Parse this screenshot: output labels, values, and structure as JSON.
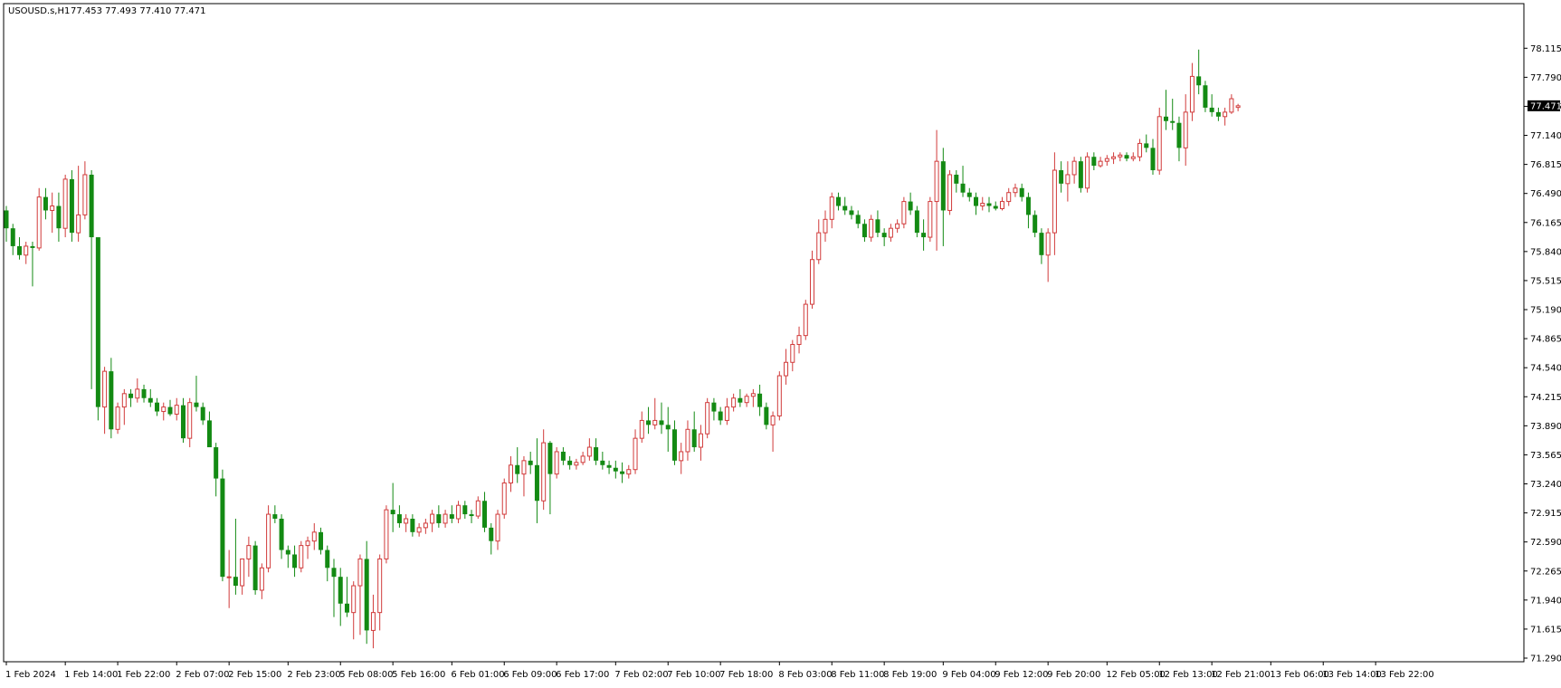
{
  "header": {
    "symbol": "USOUSD.s,H1",
    "ohlc": "77.453 77.493 77.410 77.471"
  },
  "colors": {
    "background": "#ffffff",
    "frame": "#000000",
    "bull": "#d13a3a",
    "bear": "#138a13",
    "price_label_bg": "#000000",
    "price_label_text": "#ffffff"
  },
  "chart_data": {
    "type": "candlestick",
    "grid": false,
    "ylim": [
      71.29,
      78.28
    ],
    "y_ticks": [
      "78.115",
      "77.790",
      "77.465",
      "77.140",
      "76.815",
      "76.490",
      "76.165",
      "75.840",
      "75.515",
      "75.190",
      "74.865",
      "74.540",
      "74.215",
      "73.890",
      "73.565",
      "73.240",
      "72.915",
      "72.590",
      "72.265",
      "71.940",
      "71.615",
      "71.290"
    ],
    "current_price": "77.471",
    "x_ticks": [
      {
        "label": "1 Feb 2024",
        "index": 0
      },
      {
        "label": "1 Feb 14:00",
        "index": 9
      },
      {
        "label": "1 Feb 22:00",
        "index": 17
      },
      {
        "label": "2 Feb 07:00",
        "index": 26
      },
      {
        "label": "2 Feb 15:00",
        "index": 34
      },
      {
        "label": "2 Feb 23:00",
        "index": 43
      },
      {
        "label": "5 Feb 08:00",
        "index": 51
      },
      {
        "label": "5 Feb 16:00",
        "index": 59
      },
      {
        "label": "6 Feb 01:00",
        "index": 68
      },
      {
        "label": "6 Feb 09:00",
        "index": 76
      },
      {
        "label": "6 Feb 17:00",
        "index": 84
      },
      {
        "label": "7 Feb 02:00",
        "index": 93
      },
      {
        "label": "7 Feb 10:00",
        "index": 101
      },
      {
        "label": "7 Feb 18:00",
        "index": 109
      },
      {
        "label": "8 Feb 03:00",
        "index": 118
      },
      {
        "label": "8 Feb 11:00",
        "index": 126
      },
      {
        "label": "8 Feb 19:00",
        "index": 134
      },
      {
        "label": "9 Feb 04:00",
        "index": 143
      },
      {
        "label": "9 Feb 12:00",
        "index": 151
      },
      {
        "label": "9 Feb 20:00",
        "index": 159
      },
      {
        "label": "12 Feb 05:00",
        "index": 168
      },
      {
        "label": "12 Feb 13:00",
        "index": 176
      },
      {
        "label": "12 Feb 21:00",
        "index": 184
      },
      {
        "label": "13 Feb 06:00",
        "index": 193
      },
      {
        "label": "13 Feb 14:00",
        "index": 201
      },
      {
        "label": "13 Feb 22:00",
        "index": 209
      }
    ],
    "candles": [
      [
        76.3,
        76.35,
        75.95,
        76.1
      ],
      [
        76.1,
        76.15,
        75.8,
        75.9
      ],
      [
        75.9,
        76.0,
        75.75,
        75.8
      ],
      [
        75.8,
        75.95,
        75.7,
        75.9
      ],
      [
        75.9,
        75.95,
        75.45,
        75.88
      ],
      [
        75.88,
        76.55,
        75.85,
        76.45
      ],
      [
        76.45,
        76.55,
        76.2,
        76.3
      ],
      [
        76.3,
        76.5,
        76.05,
        76.35
      ],
      [
        76.35,
        76.5,
        75.95,
        76.1
      ],
      [
        76.1,
        76.7,
        76.0,
        76.65
      ],
      [
        76.65,
        76.75,
        75.95,
        76.05
      ],
      [
        76.05,
        76.8,
        75.95,
        76.25
      ],
      [
        76.25,
        76.85,
        76.2,
        76.7
      ],
      [
        76.7,
        76.75,
        74.3,
        76.0
      ],
      [
        76.0,
        75.75,
        73.95,
        74.1
      ],
      [
        74.1,
        74.55,
        73.8,
        74.5
      ],
      [
        74.5,
        74.65,
        73.75,
        73.85
      ],
      [
        73.85,
        74.15,
        73.8,
        74.1
      ],
      [
        74.1,
        74.3,
        73.9,
        74.25
      ],
      [
        74.25,
        74.3,
        74.1,
        74.2
      ],
      [
        74.2,
        74.42,
        74.15,
        74.3
      ],
      [
        74.3,
        74.35,
        74.15,
        74.2
      ],
      [
        74.2,
        74.3,
        74.1,
        74.15
      ],
      [
        74.15,
        74.2,
        74.0,
        74.05
      ],
      [
        74.05,
        74.15,
        73.95,
        74.1
      ],
      [
        74.1,
        74.18,
        74.0,
        74.02
      ],
      [
        74.02,
        74.2,
        73.95,
        74.12
      ],
      [
        74.12,
        74.2,
        73.7,
        73.75
      ],
      [
        73.75,
        74.2,
        73.65,
        74.15
      ],
      [
        74.15,
        74.45,
        74.05,
        74.1
      ],
      [
        74.1,
        74.15,
        73.9,
        73.95
      ],
      [
        73.95,
        74.05,
        73.7,
        73.65
      ],
      [
        73.65,
        73.7,
        73.1,
        73.3
      ],
      [
        73.3,
        73.4,
        72.15,
        72.2
      ],
      [
        72.2,
        72.5,
        71.85,
        72.2
      ],
      [
        72.2,
        72.85,
        72.0,
        72.1
      ],
      [
        72.1,
        72.3,
        72.0,
        72.4
      ],
      [
        72.4,
        72.65,
        72.2,
        72.55
      ],
      [
        72.55,
        72.6,
        72.0,
        72.05
      ],
      [
        72.05,
        72.35,
        71.95,
        72.3
      ],
      [
        72.3,
        73.0,
        72.25,
        72.9
      ],
      [
        72.9,
        73.0,
        72.8,
        72.85
      ],
      [
        72.85,
        72.9,
        72.4,
        72.5
      ],
      [
        72.5,
        72.55,
        72.3,
        72.45
      ],
      [
        72.45,
        72.55,
        72.2,
        72.3
      ],
      [
        72.3,
        72.6,
        72.25,
        72.55
      ],
      [
        72.55,
        72.65,
        72.4,
        72.6
      ],
      [
        72.6,
        72.8,
        72.5,
        72.7
      ],
      [
        72.7,
        72.75,
        72.45,
        72.5
      ],
      [
        72.5,
        72.55,
        72.15,
        72.3
      ],
      [
        72.3,
        72.4,
        71.75,
        72.2
      ],
      [
        72.2,
        72.3,
        71.65,
        71.9
      ],
      [
        71.9,
        72.2,
        71.75,
        71.8
      ],
      [
        71.8,
        72.15,
        71.5,
        72.1
      ],
      [
        72.1,
        72.45,
        71.55,
        72.4
      ],
      [
        72.4,
        72.6,
        71.45,
        71.6
      ],
      [
        71.6,
        72.0,
        71.4,
        71.8
      ],
      [
        71.8,
        72.45,
        71.6,
        72.4
      ],
      [
        72.4,
        73.0,
        72.35,
        72.95
      ],
      [
        72.95,
        73.25,
        72.7,
        72.9
      ],
      [
        72.9,
        73.0,
        72.75,
        72.8
      ],
      [
        72.8,
        72.9,
        72.7,
        72.85
      ],
      [
        72.85,
        72.9,
        72.65,
        72.7
      ],
      [
        72.7,
        72.8,
        72.65,
        72.75
      ],
      [
        72.75,
        72.85,
        72.68,
        72.8
      ],
      [
        72.8,
        72.95,
        72.7,
        72.9
      ],
      [
        72.9,
        73.0,
        72.75,
        72.8
      ],
      [
        72.8,
        72.95,
        72.75,
        72.9
      ],
      [
        72.9,
        73.0,
        72.8,
        72.85
      ],
      [
        72.85,
        73.05,
        72.8,
        73.0
      ],
      [
        73.0,
        73.05,
        72.85,
        72.9
      ],
      [
        72.9,
        72.95,
        72.8,
        72.88
      ],
      [
        72.88,
        73.1,
        72.85,
        73.05
      ],
      [
        73.05,
        73.15,
        72.7,
        72.75
      ],
      [
        72.75,
        72.8,
        72.45,
        72.6
      ],
      [
        72.6,
        72.95,
        72.5,
        72.9
      ],
      [
        72.9,
        73.3,
        72.85,
        73.25
      ],
      [
        73.25,
        73.55,
        73.15,
        73.45
      ],
      [
        73.45,
        73.65,
        73.25,
        73.35
      ],
      [
        73.35,
        73.55,
        73.1,
        73.5
      ],
      [
        73.5,
        73.6,
        73.35,
        73.45
      ],
      [
        73.45,
        73.75,
        72.8,
        73.05
      ],
      [
        73.05,
        73.85,
        72.95,
        73.7
      ],
      [
        73.7,
        73.72,
        72.9,
        73.35
      ],
      [
        73.35,
        73.65,
        73.3,
        73.6
      ],
      [
        73.6,
        73.65,
        73.45,
        73.5
      ],
      [
        73.5,
        73.55,
        73.4,
        73.45
      ],
      [
        73.45,
        73.52,
        73.4,
        73.48
      ],
      [
        73.48,
        73.6,
        73.45,
        73.55
      ],
      [
        73.55,
        73.75,
        73.5,
        73.65
      ],
      [
        73.65,
        73.75,
        73.45,
        73.5
      ],
      [
        73.5,
        73.6,
        73.4,
        73.45
      ],
      [
        73.45,
        73.5,
        73.35,
        73.42
      ],
      [
        73.42,
        73.5,
        73.3,
        73.38
      ],
      [
        73.38,
        73.48,
        73.25,
        73.35
      ],
      [
        73.35,
        73.45,
        73.3,
        73.4
      ],
      [
        73.4,
        73.85,
        73.35,
        73.75
      ],
      [
        73.75,
        74.05,
        73.7,
        73.95
      ],
      [
        73.95,
        74.1,
        73.8,
        73.9
      ],
      [
        73.9,
        74.2,
        73.85,
        73.95
      ],
      [
        73.95,
        74.15,
        73.8,
        73.9
      ],
      [
        73.9,
        74.1,
        73.6,
        73.85
      ],
      [
        73.85,
        73.95,
        73.45,
        73.5
      ],
      [
        73.5,
        73.7,
        73.35,
        73.6
      ],
      [
        73.6,
        73.95,
        73.5,
        73.85
      ],
      [
        73.85,
        74.05,
        73.6,
        73.65
      ],
      [
        73.65,
        73.9,
        73.5,
        73.8
      ],
      [
        73.8,
        74.2,
        73.75,
        74.15
      ],
      [
        74.15,
        74.2,
        73.95,
        74.05
      ],
      [
        74.05,
        74.1,
        73.9,
        73.95
      ],
      [
        73.95,
        74.2,
        73.9,
        74.1
      ],
      [
        74.1,
        74.25,
        74.05,
        74.2
      ],
      [
        74.2,
        74.3,
        74.1,
        74.15
      ],
      [
        74.15,
        74.25,
        74.1,
        74.22
      ],
      [
        74.22,
        74.3,
        74.1,
        74.25
      ],
      [
        74.25,
        74.35,
        74.0,
        74.1
      ],
      [
        74.1,
        74.15,
        73.85,
        73.9
      ],
      [
        73.9,
        74.05,
        73.6,
        74.0
      ],
      [
        74.0,
        74.5,
        73.95,
        74.45
      ],
      [
        74.45,
        74.75,
        74.35,
        74.6
      ],
      [
        74.6,
        74.85,
        74.5,
        74.8
      ],
      [
        74.8,
        75.0,
        74.7,
        74.9
      ],
      [
        74.9,
        75.3,
        74.85,
        75.25
      ],
      [
        75.25,
        75.85,
        75.2,
        75.75
      ],
      [
        75.75,
        76.2,
        75.7,
        76.05
      ],
      [
        76.05,
        76.3,
        75.95,
        76.2
      ],
      [
        76.2,
        76.5,
        76.1,
        76.45
      ],
      [
        76.45,
        76.5,
        76.3,
        76.35
      ],
      [
        76.35,
        76.45,
        76.25,
        76.3
      ],
      [
        76.3,
        76.35,
        76.2,
        76.25
      ],
      [
        76.25,
        76.3,
        76.1,
        76.15
      ],
      [
        76.15,
        76.2,
        75.95,
        76.0
      ],
      [
        76.0,
        76.25,
        75.95,
        76.2
      ],
      [
        76.2,
        76.3,
        76.0,
        76.05
      ],
      [
        76.05,
        76.1,
        75.9,
        76.0
      ],
      [
        76.0,
        76.15,
        75.95,
        76.1
      ],
      [
        76.1,
        76.2,
        76.05,
        76.15
      ],
      [
        76.15,
        76.45,
        76.1,
        76.4
      ],
      [
        76.4,
        76.5,
        76.25,
        76.3
      ],
      [
        76.3,
        76.35,
        76.0,
        76.05
      ],
      [
        76.05,
        76.2,
        75.85,
        76.0
      ],
      [
        76.0,
        76.45,
        75.95,
        76.4
      ],
      [
        76.4,
        77.2,
        75.85,
        76.85
      ],
      [
        76.85,
        77.0,
        75.9,
        76.3
      ],
      [
        76.3,
        76.75,
        76.25,
        76.7
      ],
      [
        76.7,
        76.75,
        76.5,
        76.6
      ],
      [
        76.6,
        76.8,
        76.45,
        76.5
      ],
      [
        76.5,
        76.55,
        76.4,
        76.45
      ],
      [
        76.45,
        76.5,
        76.25,
        76.35
      ],
      [
        76.35,
        76.45,
        76.3,
        76.38
      ],
      [
        76.38,
        76.45,
        76.28,
        76.35
      ],
      [
        76.35,
        76.4,
        76.3,
        76.32
      ],
      [
        76.32,
        76.45,
        76.3,
        76.4
      ],
      [
        76.4,
        76.55,
        76.35,
        76.5
      ],
      [
        76.5,
        76.6,
        76.45,
        76.55
      ],
      [
        76.55,
        76.6,
        76.4,
        76.45
      ],
      [
        76.45,
        76.5,
        76.1,
        76.25
      ],
      [
        76.25,
        76.3,
        76.0,
        76.05
      ],
      [
        76.05,
        76.1,
        75.7,
        75.8
      ],
      [
        75.8,
        76.1,
        75.5,
        76.05
      ],
      [
        76.05,
        76.95,
        75.8,
        76.75
      ],
      [
        76.75,
        76.85,
        76.5,
        76.6
      ],
      [
        76.6,
        76.85,
        76.4,
        76.7
      ],
      [
        76.7,
        76.9,
        76.6,
        76.85
      ],
      [
        76.85,
        76.9,
        76.5,
        76.55
      ],
      [
        76.55,
        76.95,
        76.5,
        76.9
      ],
      [
        76.9,
        76.95,
        76.75,
        76.8
      ],
      [
        76.8,
        76.9,
        76.78,
        76.85
      ],
      [
        76.85,
        76.92,
        76.8,
        76.88
      ],
      [
        76.88,
        76.95,
        76.82,
        76.9
      ],
      [
        76.9,
        76.95,
        76.85,
        76.92
      ],
      [
        76.92,
        76.95,
        76.85,
        76.88
      ],
      [
        76.88,
        76.95,
        76.85,
        76.9
      ],
      [
        76.9,
        77.1,
        76.85,
        77.05
      ],
      [
        77.05,
        77.15,
        76.95,
        77.0
      ],
      [
        77.0,
        77.1,
        76.7,
        76.75
      ],
      [
        76.75,
        77.45,
        76.7,
        77.35
      ],
      [
        77.35,
        77.65,
        77.2,
        77.3
      ],
      [
        77.3,
        77.55,
        77.2,
        77.28
      ],
      [
        77.28,
        77.35,
        76.85,
        77.0
      ],
      [
        77.0,
        77.6,
        76.8,
        77.4
      ],
      [
        77.4,
        77.95,
        77.3,
        77.8
      ],
      [
        77.8,
        78.1,
        77.6,
        77.7
      ],
      [
        77.7,
        77.75,
        77.4,
        77.45
      ],
      [
        77.45,
        77.6,
        77.35,
        77.4
      ],
      [
        77.4,
        77.45,
        77.3,
        77.35
      ],
      [
        77.35,
        77.45,
        77.25,
        77.4
      ],
      [
        77.4,
        77.6,
        77.38,
        77.55
      ],
      [
        77.453,
        77.493,
        77.41,
        77.471
      ]
    ]
  }
}
